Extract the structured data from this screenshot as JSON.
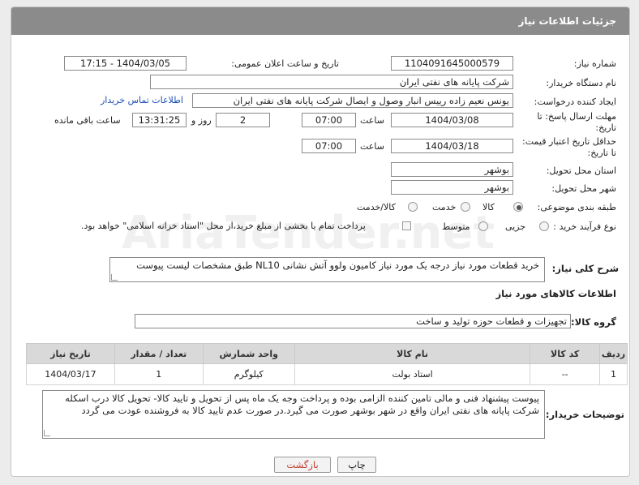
{
  "header": {
    "title": "جزئیات اطلاعات نیاز"
  },
  "watermark": "AriaTender.net",
  "fields": {
    "need_number": {
      "label": "شماره نیاز:",
      "value": "1104091645000579"
    },
    "announce": {
      "label": "تاریخ و ساعت اعلان عمومی:",
      "value": "1404/03/05 - 17:15"
    },
    "buyer_org": {
      "label": "نام دستگاه خریدار:",
      "value": "شرکت پایانه های نفتی ایران"
    },
    "requester": {
      "label": "ایجاد کننده درخواست:",
      "value": "یونس نعیم زاده رییس انبار وصول و ایصال شرکت پایانه های نفتی ایران",
      "contact_link": "اطلاعات تماس خریدار"
    },
    "deadline": {
      "label_line1": "مهلت ارسال پاسخ: تا",
      "label_line2": "تاریخ:",
      "date": "1404/03/08",
      "time_label": "ساعت",
      "time": "07:00",
      "days": "2",
      "days_label": "روز و",
      "remaining": "13:31:25",
      "remaining_label": "ساعت باقی مانده"
    },
    "price_validity": {
      "label_line1": "حداقل تاریخ اعتبار قیمت:",
      "label_line2": "تا تاریخ:",
      "date": "1404/03/18",
      "time_label": "ساعت",
      "time": "07:00"
    },
    "province": {
      "label": "استان محل تحویل:",
      "value": "بوشهر"
    },
    "city": {
      "label": "شهر محل تحویل:",
      "value": "بوشهر"
    },
    "category": {
      "label": "طبقه بندی موضوعی:",
      "options": [
        "کالا",
        "خدمت",
        "کالا/خدمت"
      ]
    },
    "purchase_type": {
      "label": "نوع فرآیند خرید :",
      "options": [
        "جزیی",
        "متوسط"
      ],
      "payment_note": "پرداخت تمام یا بخشی از مبلغ خرید،از محل \"اسناد خزانه اسلامی\" خواهد بود."
    },
    "description": {
      "label": "شرح کلی نیاز:",
      "value": "خرید قطعات مورد نیاز درجه یک مورد نیاز کامیون ولوو آتش نشانی NL10  طبق مشخصات لیست پیوست"
    }
  },
  "goods_section": {
    "title": "اطلاعات کالاهای مورد نیاز",
    "group_label": "گروه کالا:",
    "group_value": "تجهیزات و قطعات حوزه تولید و ساخت",
    "columns": [
      "ردیف",
      "کد کالا",
      "نام کالا",
      "واحد شمارش",
      "تعداد / مقدار",
      "تاریخ نیاز"
    ],
    "rows": [
      [
        "1",
        "--",
        "استاد بولت",
        "کیلوگرم",
        "1",
        "1404/03/17"
      ]
    ]
  },
  "buyer_notes": {
    "label": "توضیحات خریدار:",
    "value": "پیوست پیشنهاد فنی و مالی تامین کننده الزامی بوده و پرداخت وجه یک ماه پس از تحویل و تایید کالا- تحویل کالا درب اسکله شرکت پایانه های نفتی ایران واقع در شهر بوشهر صورت می گیرد.در صورت عدم تایید کالا به فروشنده عودت می گردد"
  },
  "buttons": {
    "print": "چاپ",
    "back": "بازگشت"
  }
}
